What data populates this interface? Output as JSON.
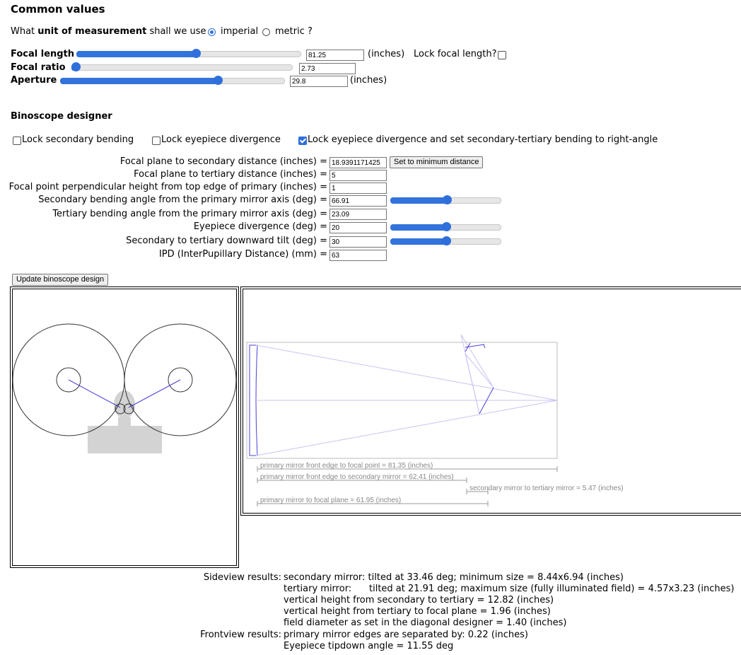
{
  "common": {
    "title": "Common values",
    "unit_q_pre": "What ",
    "unit_q_bold": "unit of measurement",
    "unit_q_post": " shall we use",
    "imperial": "imperial",
    "metric": "metric ?",
    "focal_length_label": "Focal length",
    "focal_length_value": "81.25",
    "focal_length_slider": 0.53,
    "inches": "(inches)",
    "lock_focal": "Lock focal length?",
    "focal_ratio_label": "Focal ratio",
    "focal_ratio_value": "2.73",
    "focal_ratio_slider": 0.02,
    "aperture_label": "Aperture",
    "aperture_value": "29.8",
    "aperture_slider": 0.7
  },
  "designer": {
    "title": "Binoscope designer",
    "lock_secondary": "Lock secondary bending",
    "lock_eyepiece": "Lock eyepiece divergence",
    "lock_eyepiece_right": "Lock eyepiece divergence and set secondary-tertiary bending to right-angle",
    "fields": [
      {
        "label": "Focal plane to secondary distance (inches) =",
        "value": "18.9391171425"
      },
      {
        "label": "Focal plane to tertiary distance (inches) =",
        "value": "5"
      },
      {
        "label": "Focal point perpendicular height from top edge of primary (inches) =",
        "value": "1"
      },
      {
        "label": "Secondary bending angle from the primary mirror axis (deg) =",
        "value": "66.91"
      },
      {
        "label": "Tertiary bending angle from the primary mirror axis (deg) =",
        "value": "23.09"
      },
      {
        "label": "Eyepiece divergence (deg) =",
        "value": "20"
      },
      {
        "label": "Secondary to tertiary downward tilt (deg) =",
        "value": "30"
      },
      {
        "label": "IPD (InterPupillary Distance) (mm) =",
        "value": "63"
      }
    ],
    "set_min_button": "Set to minimum distance",
    "secondary_slider": 0.51,
    "eyepiece_slider": 0.5,
    "tilt_slider": 0.5,
    "update_button": "Update binoscope design"
  },
  "sideview": {
    "dim1": "primary mirror front edge to focal point = 81.35 (inches)",
    "dim2": "primary mirror front edge to secondary mirror = 62.41 (inches)",
    "dim3": "secondary mirror to tertiary mirror = 5.47 (inches)",
    "dim4": "primary mirror to focal plane = 61.95 (inches)"
  },
  "results": {
    "sideview_label": "Sideview results:",
    "line1": "secondary mirror: tilted at 33.46 deg; minimum size = 8.44x6.94 (inches)",
    "line2a": "tertiary mirror:",
    "line2b": "tilted at 21.91 deg; maximum size (fully illuminated field) = 4.57x3.23 (inches)",
    "line3": "vertical height from secondary to tertiary = 12.82 (inches)",
    "line4": "vertical height from tertiary to focal plane = 1.96 (inches)",
    "line5": "field diameter as set in the diagonal designer = 1.40 (inches)",
    "frontview_label": "Frontview results:",
    "line6": "primary mirror edges are separated by: 0.22 (inches)",
    "line7": "Eyepiece tipdown angle = 11.55 deg"
  },
  "colors": {
    "accent": "#2f6fdb",
    "trace": "#4a3fd6",
    "light_trace": "#c8c4f2",
    "head": "#d3d3d3"
  }
}
